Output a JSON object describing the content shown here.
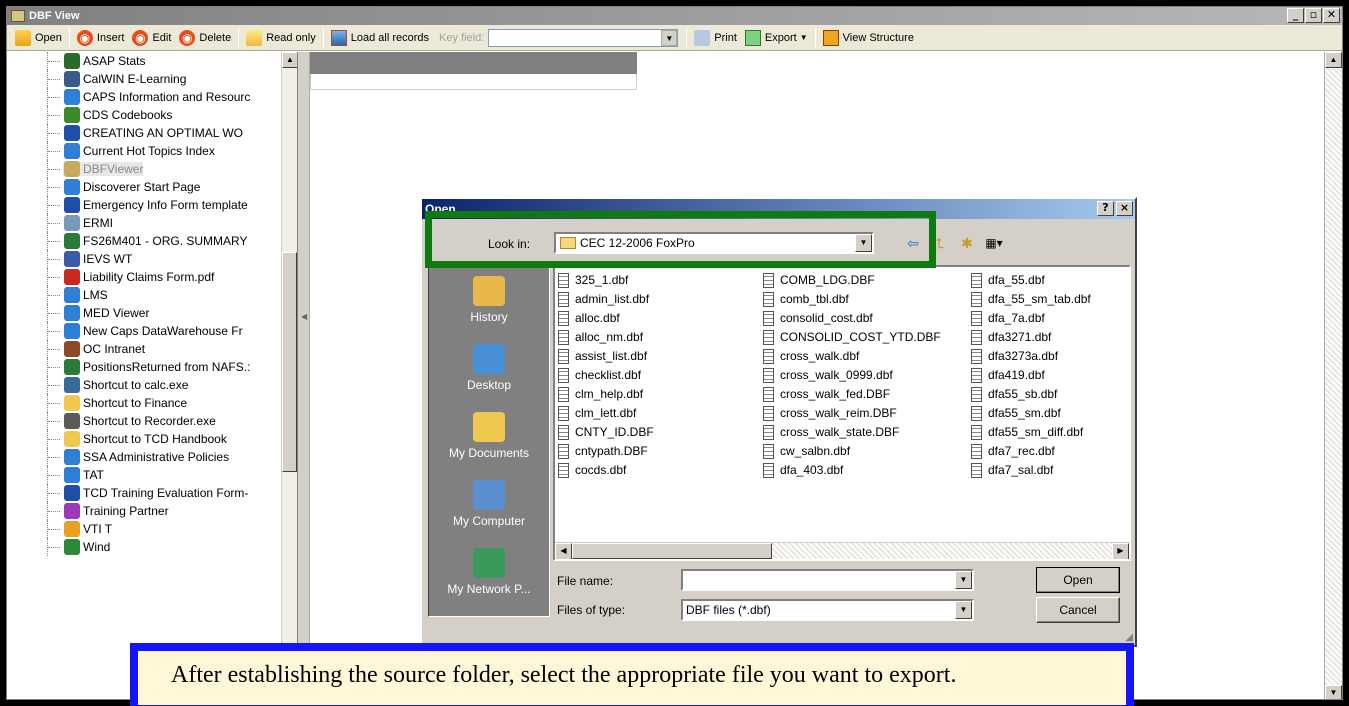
{
  "window": {
    "title": "DBF View"
  },
  "toolbar": {
    "open": "Open",
    "insert": "Insert",
    "edit": "Edit",
    "delete": "Delete",
    "read_only": "Read only",
    "load_all": "Load all records",
    "key_field_label": "Key field:",
    "key_field_value": "",
    "print": "Print",
    "export": "Export",
    "view_structure": "View Structure"
  },
  "tree": {
    "items": [
      {
        "label": "ASAP Stats",
        "icon": "app-icon",
        "color": "#2a6a2a"
      },
      {
        "label": "CalWIN E-Learning",
        "icon": "monitor-icon",
        "color": "#3a5a8a"
      },
      {
        "label": "CAPS Information and Resourc",
        "icon": "ie-icon",
        "color": "#2f7fd6"
      },
      {
        "label": "CDS Codebooks",
        "icon": "tree-icon",
        "color": "#3a8a2a"
      },
      {
        "label": "CREATING AN OPTIMAL WO",
        "icon": "word-icon",
        "color": "#1f4ea8"
      },
      {
        "label": "Current Hot Topics Index",
        "icon": "ie-icon",
        "color": "#2f7fd6"
      },
      {
        "label": "DBFViewer",
        "icon": "dbf-icon",
        "color": "#c8a85a"
      },
      {
        "label": "Discoverer Start Page",
        "icon": "ie-icon",
        "color": "#2f7fd6"
      },
      {
        "label": "Emergency Info Form template",
        "icon": "word-icon",
        "color": "#1f4ea8"
      },
      {
        "label": "ERMI",
        "icon": "shortcut-icon",
        "color": "#7a9ab8"
      },
      {
        "label": "FS26M401 - ORG. SUMMARY",
        "icon": "excel-icon",
        "color": "#2a7a3a"
      },
      {
        "label": "IEVS WT",
        "icon": "app-icon",
        "color": "#3a5aa8"
      },
      {
        "label": "Liability Claims Form.pdf",
        "icon": "pdf-icon",
        "color": "#c8281e"
      },
      {
        "label": "LMS",
        "icon": "ie-icon",
        "color": "#2f7fd6"
      },
      {
        "label": "MED Viewer",
        "icon": "ie-icon",
        "color": "#2f7fd6"
      },
      {
        "label": "New Caps DataWarehouse Fr",
        "icon": "ie-icon",
        "color": "#2f7fd6"
      },
      {
        "label": "OC Intranet",
        "icon": "page-icon",
        "color": "#8a4a2a"
      },
      {
        "label": "PositionsReturned from NAFS.:",
        "icon": "excel-icon",
        "color": "#2a7a3a"
      },
      {
        "label": "Shortcut to calc.exe",
        "icon": "calc-icon",
        "color": "#3a6a9a"
      },
      {
        "label": "Shortcut to Finance",
        "icon": "folder-icon",
        "color": "#f0c850"
      },
      {
        "label": "Shortcut to Recorder.exe",
        "icon": "recorder-icon",
        "color": "#5a5a5a"
      },
      {
        "label": "Shortcut to TCD Handbook",
        "icon": "folder-icon",
        "color": "#f0c850"
      },
      {
        "label": "SSA Administrative Policies",
        "icon": "ie-icon",
        "color": "#2f7fd6"
      },
      {
        "label": "TAT",
        "icon": "ie-icon",
        "color": "#2f7fd6"
      },
      {
        "label": "TCD Training Evaluation Form-",
        "icon": "word-icon",
        "color": "#1f4ea8"
      },
      {
        "label": "Training Partner",
        "icon": "app-icon",
        "color": "#9a3ab8"
      },
      {
        "label": "VTI T",
        "icon": "app-icon",
        "color": "#e8a020"
      },
      {
        "label": "Wind",
        "icon": "media-icon",
        "color": "#2a8a3a"
      }
    ]
  },
  "dialog": {
    "title": "Open",
    "help_btn": "?",
    "close_btn": "×",
    "look_in_label": "Look in:",
    "look_in_value": "CEC 12-2006 FoxPro",
    "places": [
      {
        "label": "History",
        "icon": "history-icon",
        "color": "#e8b84a"
      },
      {
        "label": "Desktop",
        "icon": "desktop-icon",
        "color": "#4a90d8"
      },
      {
        "label": "My Documents",
        "icon": "my-documents-icon",
        "color": "#f0c850"
      },
      {
        "label": "My Computer",
        "icon": "my-computer-icon",
        "color": "#5a90d0"
      },
      {
        "label": "My Network P...",
        "icon": "network-icon",
        "color": "#3a9a5a"
      }
    ],
    "files": {
      "col1": [
        "325_1.dbf",
        "admin_list.dbf",
        "alloc.dbf",
        "alloc_nm.dbf",
        "assist_list.dbf",
        "checklist.dbf",
        "clm_help.dbf",
        "clm_lett.dbf",
        "CNTY_ID.DBF",
        "cntypath.DBF",
        "cocds.dbf"
      ],
      "col2": [
        "COMB_LDG.DBF",
        "comb_tbl.dbf",
        "consolid_cost.dbf",
        "CONSOLID_COST_YTD.DBF",
        "cross_walk.dbf",
        "cross_walk_0999.dbf",
        "cross_walk_fed.DBF",
        "cross_walk_reim.DBF",
        "cross_walk_state.DBF",
        "cw_salbn.dbf",
        "dfa_403.dbf"
      ],
      "col3": [
        "dfa_55.dbf",
        "dfa_55_sm_tab.dbf",
        "dfa_7a.dbf",
        "dfa3271.dbf",
        "dfa3273a.dbf",
        "dfa419.dbf",
        "dfa55_sb.dbf",
        "dfa55_sm.dbf",
        "dfa55_sm_diff.dbf",
        "dfa7_rec.dbf",
        "dfa7_sal.dbf"
      ]
    },
    "file_name_label": "File name:",
    "file_name_value": "",
    "files_of_type_label": "Files of type:",
    "files_of_type_value": "DBF files (*.dbf)",
    "open_btn": "Open",
    "cancel_btn": "Cancel"
  },
  "caption": "After establishing the source folder, select the appropriate file you want to export.",
  "colors": {
    "highlight_green": "#0e7a10",
    "highlight_blue": "#1414ff"
  }
}
